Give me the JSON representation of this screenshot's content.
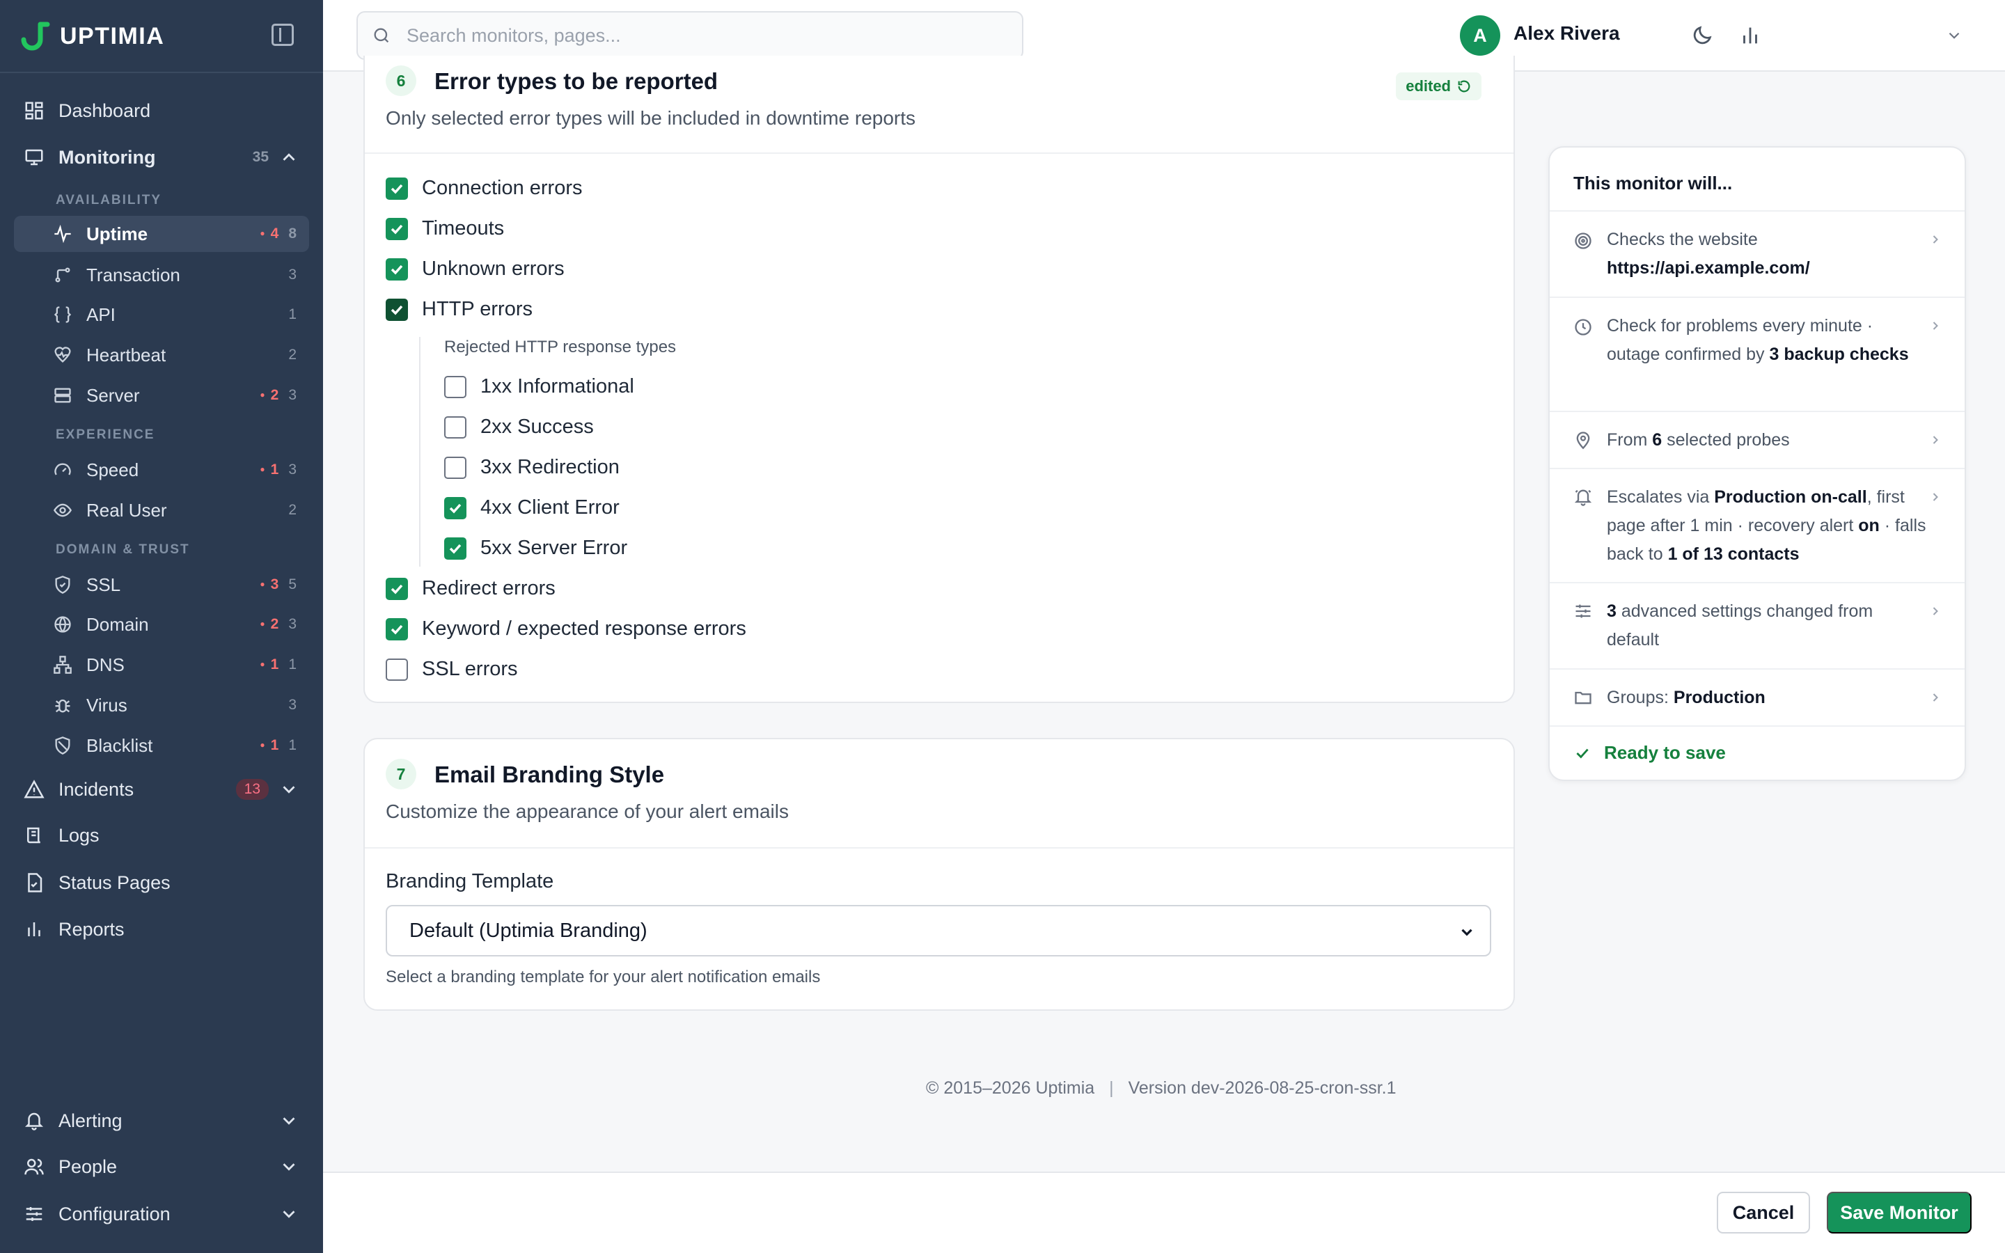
{
  "app": {
    "logo_text": "UPTIMIA",
    "brand_color": "#15935a"
  },
  "search": {
    "placeholder": "Search monitors, pages..."
  },
  "user": {
    "initial": "A",
    "name": "Alex Rivera"
  },
  "sidebar": {
    "dashboard": "Dashboard",
    "monitoring": {
      "label": "Monitoring",
      "count": "35"
    },
    "sections": {
      "availability": "AVAILABILITY",
      "experience": "EXPERIENCE",
      "domain_trust": "DOMAIN & TRUST"
    },
    "items": [
      {
        "label": "Uptime",
        "alert": "4",
        "count": "8",
        "icon": "pulse-icon"
      },
      {
        "label": "Transaction",
        "alert": "",
        "count": "3",
        "icon": "transaction-icon"
      },
      {
        "label": "API",
        "alert": "",
        "count": "1",
        "icon": "braces-icon"
      },
      {
        "label": "Heartbeat",
        "alert": "",
        "count": "2",
        "icon": "heart-pulse-icon"
      },
      {
        "label": "Server",
        "alert": "2",
        "count": "3",
        "icon": "server-icon"
      },
      {
        "label": "Speed",
        "alert": "1",
        "count": "3",
        "icon": "gauge-icon"
      },
      {
        "label": "Real User",
        "alert": "",
        "count": "2",
        "icon": "eye-icon"
      },
      {
        "label": "SSL",
        "alert": "3",
        "count": "5",
        "icon": "shield-icon"
      },
      {
        "label": "Domain",
        "alert": "2",
        "count": "3",
        "icon": "globe-icon"
      },
      {
        "label": "DNS",
        "alert": "1",
        "count": "1",
        "icon": "network-icon"
      },
      {
        "label": "Virus",
        "alert": "",
        "count": "3",
        "icon": "bug-icon"
      },
      {
        "label": "Blacklist",
        "alert": "1",
        "count": "1",
        "icon": "shield-off-icon"
      }
    ],
    "incidents": {
      "label": "Incidents",
      "badge": "13"
    },
    "logs": "Logs",
    "status_pages": "Status Pages",
    "reports": "Reports",
    "alerting": "Alerting",
    "people": "People",
    "configuration": "Configuration"
  },
  "error_types": {
    "step": "6",
    "title": "Error types to be reported",
    "subtitle": "Only selected error types will be included in downtime reports",
    "edited": "edited",
    "options": {
      "connection": "Connection errors",
      "timeouts": "Timeouts",
      "unknown": "Unknown errors",
      "http": "HTTP errors",
      "redirect": "Redirect errors",
      "keyword": "Keyword / expected response errors",
      "ssl": "SSL errors"
    },
    "http_sub_title": "Rejected HTTP response types",
    "http_types": {
      "1xx": "1xx Informational",
      "2xx": "2xx Success",
      "3xx": "3xx Redirection",
      "4xx": "4xx Client Error",
      "5xx": "5xx Server Error"
    },
    "checked": {
      "connection": true,
      "timeouts": true,
      "unknown": true,
      "http": true,
      "1xx": false,
      "2xx": false,
      "3xx": false,
      "4xx": true,
      "5xx": true,
      "redirect": true,
      "keyword": true,
      "ssl": false
    }
  },
  "branding": {
    "step": "7",
    "title": "Email Branding Style",
    "subtitle": "Customize the appearance of your alert emails",
    "field_label": "Branding Template",
    "selected": "Default (Uptimia Branding)",
    "help": "Select a branding template for your alert notification emails"
  },
  "footer": {
    "copyright": "© 2015–2026 Uptimia",
    "version": "Version dev-2026-08-25-cron-ssr.1"
  },
  "actions": {
    "cancel": "Cancel",
    "save": "Save Monitor"
  },
  "summary": {
    "title": "This monitor will...",
    "website_prefix": "Checks the website",
    "website_url": "https://api.example.com/",
    "check_prefix": "Check for problems every minute · outage confirmed by",
    "check_bold": "3 backup checks",
    "probes_prefix": "From",
    "probes_count": "6",
    "probes_suffix": "selected probes",
    "escalate_prefix": "Escalates via",
    "escalate_policy": "Production on-call",
    "escalate_mid": ", first page after 1 min · recovery alert",
    "escalate_on": "on",
    "escalate_mid2": "· falls back to",
    "escalate_contacts": "1 of 13 contacts",
    "advanced_count": "3",
    "advanced_suffix": "advanced settings changed from default",
    "groups_prefix": "Groups:",
    "groups_value": "Production",
    "ready": "Ready to save"
  }
}
